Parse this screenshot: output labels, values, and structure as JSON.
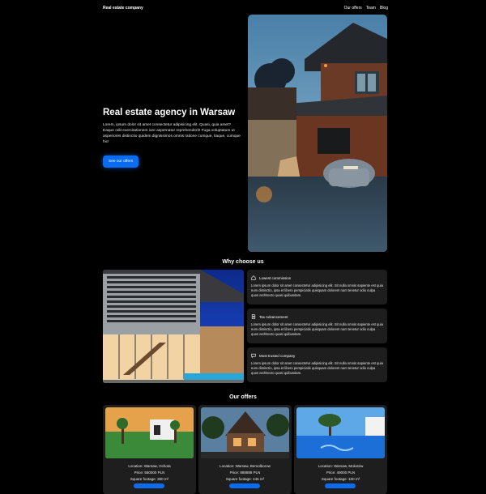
{
  "nav": {
    "brand": "Real estate company",
    "links": [
      "Our offers",
      "Team",
      "Blog"
    ]
  },
  "hero": {
    "title": "Real estate agency in Warsaw",
    "description": "Lorem, ipsum dolor sit amet consectetur adipisicing elit. Quasi, quia amet? Eaque odit exercitationem iure aspernatur reprehenderit! Fuga voluptatum ut asperiores distinctio quidem dignissimos omnis ratione cumque, itaque, cumque hic!",
    "button": "See our offers"
  },
  "why": {
    "title": "Why choose us",
    "features": [
      {
        "icon": "home-icon",
        "title": "Lowest commission",
        "text": "Lorem ipsum dolor sit amet consectetur adipisicing elit. Sit nulla omnis sapiente est quia eum distinctio, ipsa et libero perspiciatis quisquam dolorem nam tenetur odio culpa quos architecto quasi quibusdam."
      },
      {
        "icon": "document-icon",
        "title": "Tax Advancement",
        "text": "Lorem ipsum dolor sit amet consectetur adipisicing elit. Sit nulla omnis sapiente est quia eum distinctio, ipsa et libero perspiciatis quisquam dolorem nam tenetur odio culpa quos architecto quasi quibusdam."
      },
      {
        "icon": "chat-icon",
        "title": "Most trusted company",
        "text": "Lorem ipsum dolor sit amet consectetur adipisicing elit. Sit nulla omnis sapiente est quia eum distinctio, ipsa et libero perspiciatis quisquam dolorem nam tenetur odio culpa quos architecto quasi quibusdam."
      }
    ]
  },
  "offers": {
    "title": "Our offers",
    "cards": [
      {
        "location": "Location: Warsaw, Ochota",
        "price": "Price: 550000 PLN",
        "footage": "Square footage: 300 m²"
      },
      {
        "location": "Location: Warsaw, Bemolborow",
        "price": "Price: 888888 PLN",
        "footage": "Square footage: 445 m²"
      },
      {
        "location": "Location: Warsaw, Mokotów",
        "price": "Price: 49000 PLN",
        "footage": "Square footage: 100 m²"
      }
    ]
  },
  "colors": {
    "background": "#000000",
    "card": "#1e1e1e",
    "accent": "#0a6cf0"
  }
}
